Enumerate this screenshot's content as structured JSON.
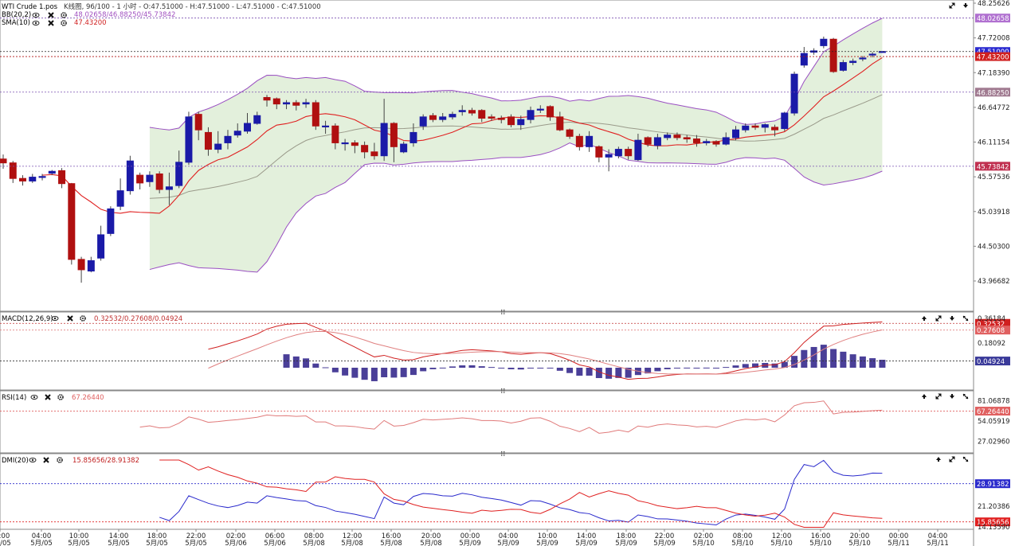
{
  "main_pane": {
    "symbol": "WTI Crude 1.pos",
    "info": "K线图, 96/100 - 1 小时 - O:47.51000 - H:47.51000 - L:47.51000 - C:47.51000",
    "bb_label": "BB(20,2)",
    "bb_values": "48.02658/46.88250/45.73842",
    "sma_label": "SMA(10)",
    "sma_value": "47.43200",
    "y_ticks": [
      "48.25626",
      "47.72008",
      "47.18390",
      "46.64772",
      "46.11154",
      "45.57536",
      "45.03918",
      "44.50300",
      "43.96682"
    ],
    "badges": {
      "bb_upper": "48.02658",
      "last": "47.51000",
      "sma": "47.43200",
      "bb_mid": "46.88250",
      "bb_lower": "45.73842"
    }
  },
  "macd_pane": {
    "label": "MACD(12,26,9)",
    "values": "0.32532/0.27608/0.04924",
    "y_ticks": [
      "0.36184",
      "0.18092"
    ],
    "badges": {
      "macd": "0.32532",
      "signal": "0.27608",
      "hist": "0.04924"
    }
  },
  "rsi_pane": {
    "label": "RSI(14)",
    "values": "67.26440",
    "y_ticks": [
      "81.06878",
      "54.05919",
      "27.02960"
    ],
    "badges": {
      "rsi": "67.26440"
    }
  },
  "dmi_pane": {
    "label": "DMI(20)",
    "values": "15.85656/28.91382",
    "y_ticks": [
      "21.20386",
      "14.13590"
    ],
    "badges": {
      "plus": "28.91382",
      "minus": "15.85656"
    }
  },
  "x_axis": [
    {
      "t": "00:00",
      "d": "5月/05"
    },
    {
      "t": "04:00",
      "d": "5月/05"
    },
    {
      "t": "10:00",
      "d": "5月/05"
    },
    {
      "t": "14:00",
      "d": "5月/05"
    },
    {
      "t": "18:00",
      "d": "5月/05"
    },
    {
      "t": "22:00",
      "d": "5月/05"
    },
    {
      "t": "02:00",
      "d": "5月/06"
    },
    {
      "t": "06:00",
      "d": "5月/06"
    },
    {
      "t": "08:00",
      "d": "5月/08"
    },
    {
      "t": "12:00",
      "d": "5月/08"
    },
    {
      "t": "16:00",
      "d": "5月/08"
    },
    {
      "t": "20:00",
      "d": "5月/08"
    },
    {
      "t": "00:00",
      "d": "5月/09"
    },
    {
      "t": "04:00",
      "d": "5月/09"
    },
    {
      "t": "10:00",
      "d": "5月/09"
    },
    {
      "t": "14:00",
      "d": "5月/09"
    },
    {
      "t": "18:00",
      "d": "5月/09"
    },
    {
      "t": "22:00",
      "d": "5月/09"
    },
    {
      "t": "02:00",
      "d": "5月/10"
    },
    {
      "t": "08:00",
      "d": "5月/10"
    },
    {
      "t": "12:00",
      "d": "5月/10"
    },
    {
      "t": "16:00",
      "d": "5月/10"
    },
    {
      "t": "20:00",
      "d": "5月/10"
    },
    {
      "t": "00:00",
      "d": "5月/11"
    },
    {
      "t": "04:00",
      "d": "5月/11"
    }
  ],
  "colors": {
    "up": "#1a1aa8",
    "down": "#b01010",
    "sma": "#e02020",
    "bb_fill": "#e3f0dc",
    "bb_line": "#9a4fc2",
    "grid_dash": "#7a4fb0"
  },
  "icons": [
    "eye-icon",
    "close-icon",
    "gear-icon",
    "arrow-up-icon",
    "expand-icon",
    "arrow-down-icon"
  ],
  "chart_data": [
    {
      "type": "candlestick",
      "ylim": [
        43.96682,
        48.25626
      ],
      "candles": [
        [
          45.85,
          45.79,
          45.92,
          45.7
        ],
        [
          45.79,
          45.55,
          45.82,
          45.48
        ],
        [
          45.55,
          45.51,
          45.6,
          45.44
        ],
        [
          45.51,
          45.57,
          45.62,
          45.48
        ],
        [
          45.57,
          45.58,
          45.62,
          45.52
        ],
        [
          45.63,
          45.66,
          45.68,
          45.6
        ],
        [
          45.67,
          45.47,
          45.71,
          45.4
        ],
        [
          45.47,
          44.3,
          45.48,
          44.22
        ],
        [
          44.3,
          44.14,
          44.34,
          43.94
        ],
        [
          44.12,
          44.28,
          44.34,
          44.1
        ],
        [
          44.32,
          44.68,
          44.82,
          44.28
        ],
        [
          44.7,
          45.08,
          45.12,
          44.66
        ],
        [
          45.12,
          45.36,
          45.55,
          45.06
        ],
        [
          45.36,
          45.82,
          45.9,
          45.3
        ],
        [
          45.6,
          45.48,
          45.64,
          45.38
        ],
        [
          45.5,
          45.6,
          45.66,
          45.42
        ],
        [
          45.62,
          45.38,
          45.66,
          45.32
        ],
        [
          45.38,
          45.42,
          45.64,
          45.14
        ],
        [
          45.44,
          45.8,
          45.98,
          45.4
        ],
        [
          45.8,
          46.5,
          46.58,
          45.76
        ],
        [
          46.54,
          46.3,
          46.58,
          46.14
        ],
        [
          46.26,
          46.0,
          46.34,
          45.9
        ],
        [
          46.0,
          46.08,
          46.28,
          45.94
        ],
        [
          46.1,
          46.2,
          46.3,
          46.0
        ],
        [
          46.22,
          46.28,
          46.4,
          46.18
        ],
        [
          46.28,
          46.4,
          46.56,
          46.24
        ],
        [
          46.4,
          46.52,
          46.58,
          46.38
        ],
        [
          46.8,
          46.76,
          46.84,
          46.66
        ],
        [
          46.78,
          46.7,
          46.8,
          46.62
        ],
        [
          46.7,
          46.72,
          46.76,
          46.62
        ],
        [
          46.72,
          46.68,
          46.76,
          46.6
        ],
        [
          46.7,
          46.72,
          46.78,
          46.64
        ],
        [
          46.72,
          46.36,
          46.76,
          46.3
        ],
        [
          46.36,
          46.36,
          46.44,
          46.24
        ],
        [
          46.36,
          46.1,
          46.4,
          46.0
        ],
        [
          46.1,
          46.1,
          46.16,
          45.98
        ],
        [
          46.1,
          46.06,
          46.14,
          45.94
        ],
        [
          46.06,
          45.96,
          46.12,
          45.86
        ],
        [
          45.96,
          45.9,
          46.1,
          45.84
        ],
        [
          45.9,
          46.4,
          46.78,
          45.82
        ],
        [
          46.4,
          46.04,
          46.42,
          45.8
        ],
        [
          45.96,
          46.08,
          46.12,
          45.94
        ],
        [
          46.1,
          46.26,
          46.4,
          46.04
        ],
        [
          46.36,
          46.5,
          46.54,
          46.3
        ],
        [
          46.52,
          46.46,
          46.56,
          46.42
        ],
        [
          46.46,
          46.5,
          46.56,
          46.42
        ],
        [
          46.5,
          46.54,
          46.58,
          46.46
        ],
        [
          46.58,
          46.6,
          46.68,
          46.52
        ],
        [
          46.6,
          46.56,
          46.64,
          46.52
        ],
        [
          46.6,
          46.48,
          46.62,
          46.42
        ],
        [
          46.5,
          46.48,
          46.54,
          46.44
        ],
        [
          46.48,
          46.46,
          46.52,
          46.4
        ],
        [
          46.5,
          46.38,
          46.54,
          46.34
        ],
        [
          46.38,
          46.46,
          46.52,
          46.3
        ],
        [
          46.46,
          46.6,
          46.66,
          46.4
        ],
        [
          46.62,
          46.62,
          46.68,
          46.56
        ],
        [
          46.66,
          46.5,
          46.68,
          46.44
        ],
        [
          46.5,
          46.3,
          46.58,
          46.28
        ],
        [
          46.3,
          46.2,
          46.32,
          46.16
        ],
        [
          46.2,
          46.04,
          46.24,
          45.98
        ],
        [
          46.04,
          46.2,
          46.28,
          45.96
        ],
        [
          46.04,
          45.88,
          46.06,
          45.8
        ],
        [
          45.88,
          45.92,
          46.0,
          45.66
        ],
        [
          45.9,
          46.0,
          46.04,
          45.86
        ],
        [
          46.0,
          45.9,
          46.04,
          45.84
        ],
        [
          45.84,
          46.14,
          46.24,
          45.82
        ],
        [
          46.18,
          46.08,
          46.2,
          46.04
        ],
        [
          46.06,
          46.18,
          46.24,
          46.0
        ],
        [
          46.18,
          46.22,
          46.26,
          46.14
        ],
        [
          46.22,
          46.18,
          46.26,
          46.14
        ],
        [
          46.18,
          46.16,
          46.22,
          46.1
        ],
        [
          46.16,
          46.1,
          46.22,
          46.04
        ],
        [
          46.1,
          46.12,
          46.16,
          46.06
        ],
        [
          46.12,
          46.08,
          46.14,
          46.04
        ],
        [
          46.08,
          46.18,
          46.26,
          46.06
        ],
        [
          46.18,
          46.3,
          46.36,
          46.14
        ],
        [
          46.3,
          46.36,
          46.4,
          46.26
        ],
        [
          46.36,
          46.34,
          46.4,
          46.3
        ],
        [
          46.34,
          46.38,
          46.4,
          46.26
        ],
        [
          46.34,
          46.3,
          46.38,
          46.2
        ],
        [
          46.32,
          46.56,
          46.58,
          46.28
        ],
        [
          46.56,
          47.16,
          47.2,
          46.52
        ],
        [
          47.3,
          47.48,
          47.58,
          47.26
        ],
        [
          47.5,
          47.52,
          47.56,
          47.46
        ],
        [
          47.6,
          47.7,
          47.74,
          47.56
        ],
        [
          47.7,
          47.2,
          47.72,
          47.18
        ],
        [
          47.22,
          47.34,
          47.38,
          47.2
        ],
        [
          47.34,
          47.36,
          47.4,
          47.3
        ],
        [
          47.4,
          47.41,
          47.44,
          47.36
        ],
        [
          47.46,
          47.47,
          47.5,
          47.42
        ],
        [
          47.51,
          47.51,
          47.51,
          47.51
        ]
      ]
    },
    {
      "type": "line",
      "name": "MACD(12,26,9)",
      "series": [
        "MACD",
        "signal",
        "histogram"
      ],
      "ylim": [
        -0.14,
        0.36184
      ],
      "last": {
        "macd": 0.32532,
        "signal": 0.27608,
        "histogram": 0.04924
      }
    },
    {
      "type": "line",
      "name": "RSI(14)",
      "ylim": [
        14.0,
        90.0
      ],
      "last": 67.2644
    },
    {
      "type": "line",
      "name": "DMI(20)",
      "series": [
        "+DI",
        "-DI"
      ],
      "ylim": [
        14.1359,
        37.0
      ],
      "last": {
        "plus_di": 28.91382,
        "minus_di": 15.85656
      }
    }
  ]
}
